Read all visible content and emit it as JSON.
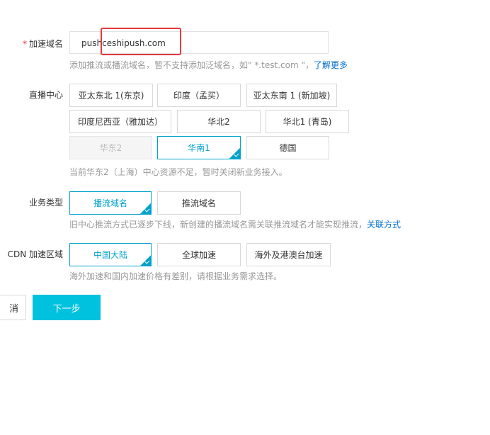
{
  "domain": {
    "required_mark": "*",
    "label": "加速域名",
    "value": "pushceshipush.com",
    "hint": "添加推流或播流域名，暂不支持添加泛域名，如\" *.test.com \"，",
    "hint_link": "了解更多"
  },
  "live_center": {
    "label": "直播中心",
    "options": [
      {
        "label": "亚太东北 1(东京)",
        "state": "normal"
      },
      {
        "label": "印度（孟买）",
        "state": "normal"
      },
      {
        "label": "亚太东南 1 (新加坡)",
        "state": "normal"
      },
      {
        "label": "印度尼西亚（雅加达）",
        "state": "normal"
      },
      {
        "label": "华北2",
        "state": "normal"
      },
      {
        "label": "华北1 (青岛)",
        "state": "normal"
      },
      {
        "label": "华东2",
        "state": "disabled"
      },
      {
        "label": "华南1",
        "state": "selected"
      },
      {
        "label": "德国",
        "state": "normal"
      }
    ],
    "hint": "当前华东2（上海）中心资源不足，暂时关闭新业务接入。"
  },
  "business_type": {
    "label": "业务类型",
    "options": [
      {
        "label": "播流域名",
        "state": "selected"
      },
      {
        "label": "推流域名",
        "state": "normal"
      }
    ],
    "hint": "旧中心推流方式已逐步下线，新创建的播流域名需关联推流域名才能实现推流，",
    "hint_link": "关联方式"
  },
  "cdn_region": {
    "label": "CDN 加速区域",
    "options": [
      {
        "label": "中国大陆",
        "state": "selected"
      },
      {
        "label": "全球加速",
        "state": "normal"
      },
      {
        "label": "海外及港澳台加速",
        "state": "normal"
      }
    ],
    "hint": "海外加速和国内加速价格有差别，请根据业务需求选择。"
  },
  "actions": {
    "cancel": "消",
    "next": "下一步"
  },
  "colors": {
    "accent": "#00a2ca",
    "primary_button": "#00c1de",
    "link": "#0070cc",
    "annotation_box": "#e4393c"
  }
}
